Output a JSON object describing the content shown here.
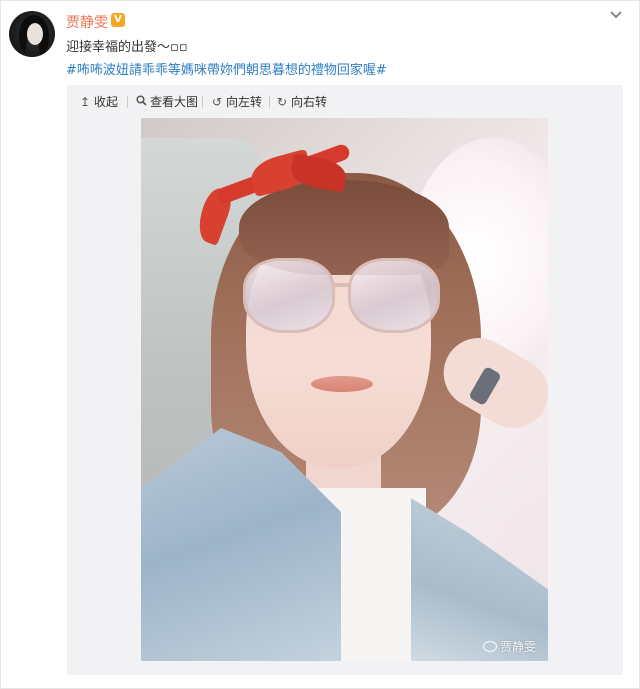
{
  "post": {
    "author": "贾静雯",
    "verified_badge": "V",
    "text": "迎接幸福的出發～▫▫",
    "hashtags": "#咘咘波妞請乖乖等媽咪帶妳們朝思暮想的禮物回家喔#",
    "more_icon": "chevron-down-icon"
  },
  "media_toolbar": {
    "collapse": "收起",
    "view_large": "查看大图",
    "rotate_left": "向左转",
    "rotate_right": "向右转"
  },
  "photo": {
    "watermark": "贾静雯"
  },
  "colors": {
    "name": "#eb7350",
    "hashtag": "#2e7ec2",
    "verified": "#f6a623",
    "panel": "#f2f2f5"
  }
}
